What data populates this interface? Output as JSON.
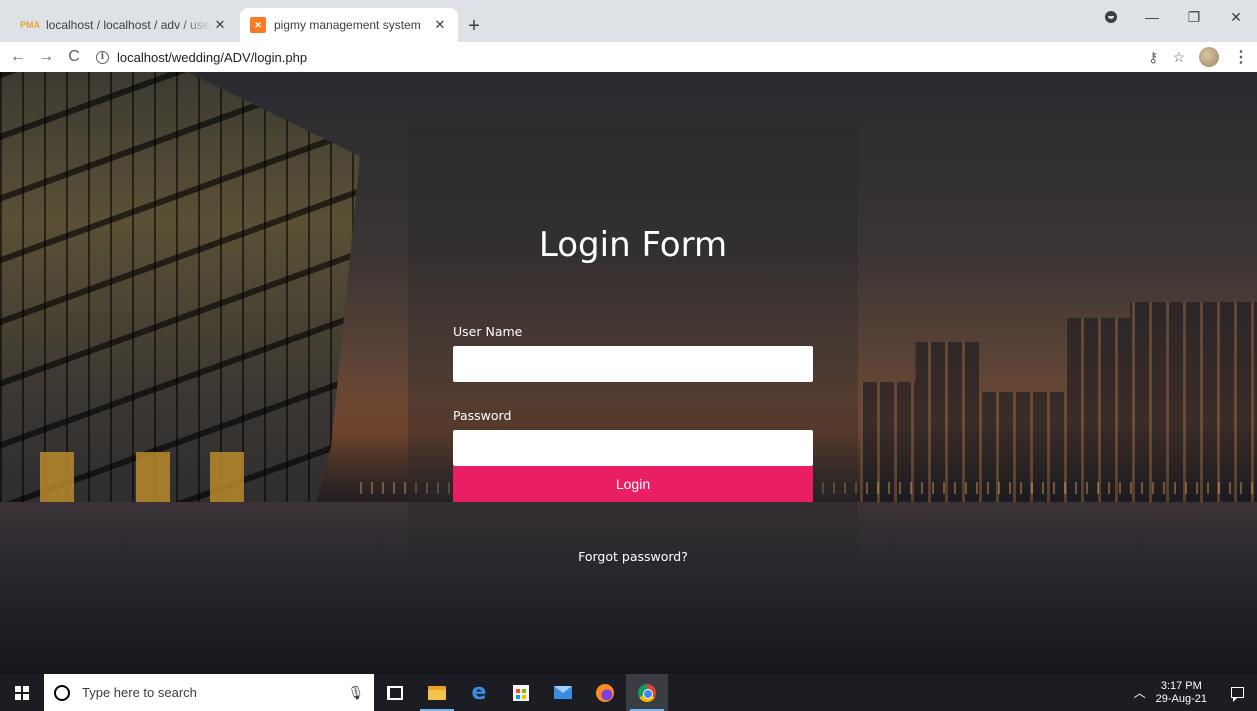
{
  "browser": {
    "tabs": [
      {
        "title": "localhost / localhost / adv / users",
        "favicon": "phpmyadmin-icon",
        "active": false
      },
      {
        "title": "pigmy management system",
        "favicon": "xampp-icon",
        "active": true
      }
    ],
    "new_tab_symbol": "+",
    "url": "localhost/wedding/ADV/login.php",
    "icons": [
      "back-icon",
      "forward-icon",
      "reload-icon",
      "info-icon",
      "key-icon",
      "star-icon",
      "profile-avatar",
      "kebab-menu-icon"
    ]
  },
  "login": {
    "title": "Login Form",
    "username_label": "User Name",
    "username_value": "",
    "password_label": "Password",
    "password_value": "",
    "login_button": "Login",
    "forgot_link": "Forgot password?",
    "accent_color": "#e91e63"
  },
  "taskbar": {
    "search_placeholder": "Type here to search",
    "apps": [
      "task-view-icon",
      "file-explorer-icon",
      "edge-icon",
      "store-icon",
      "mail-icon",
      "firefox-icon",
      "chrome-icon"
    ],
    "time": "3:17 PM",
    "date": "29-Aug-21"
  }
}
